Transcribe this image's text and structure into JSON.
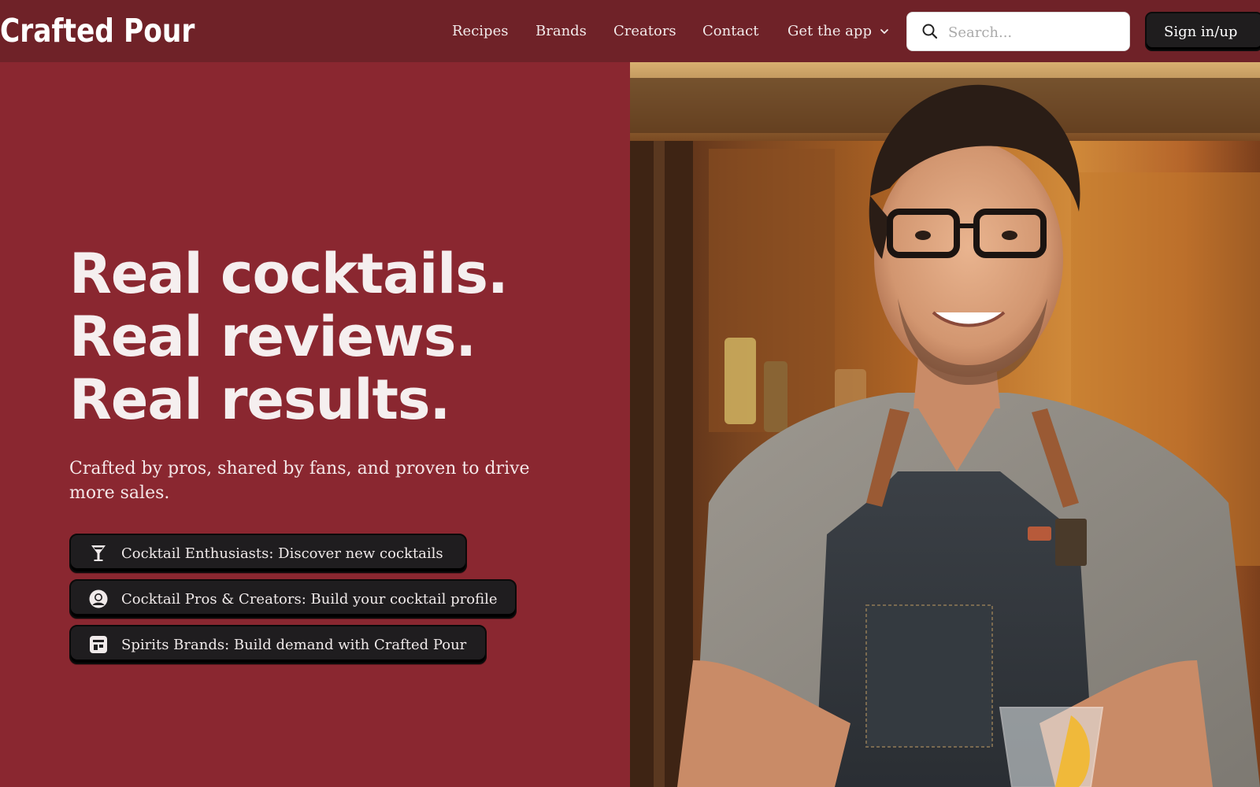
{
  "brand": {
    "logo_text": "Crafted Pour"
  },
  "nav": {
    "items": [
      {
        "label": "Recipes"
      },
      {
        "label": "Brands"
      },
      {
        "label": "Creators"
      },
      {
        "label": "Contact"
      },
      {
        "label": "Get the app"
      }
    ]
  },
  "search": {
    "placeholder": "Search..."
  },
  "auth": {
    "signin_label": "Sign in/up"
  },
  "hero": {
    "headline": [
      "Real cocktails.",
      "Real reviews.",
      "Real results."
    ],
    "subtitle": "Crafted by pros, shared by fans, and proven to drive more sales.",
    "ctas": [
      {
        "label": "Cocktail Enthusiasts: Discover new cocktails",
        "icon": "cocktail-glass-icon"
      },
      {
        "label": "Cocktail Pros & Creators: Build your cocktail profile",
        "icon": "user-profile-icon"
      },
      {
        "label": "Spirits Brands: Build demand with Crafted Pour",
        "icon": "storefront-icon"
      }
    ]
  },
  "image": {
    "subject": "Smiling bartender with glasses in gray t-shirt and denim apron with leather straps, in a warmly lit bar"
  },
  "colors": {
    "hero_background": "#8a2730",
    "topbar_background": "#6f2228",
    "button_dark": "#1f1d1e",
    "text_light": "#f5efef"
  }
}
